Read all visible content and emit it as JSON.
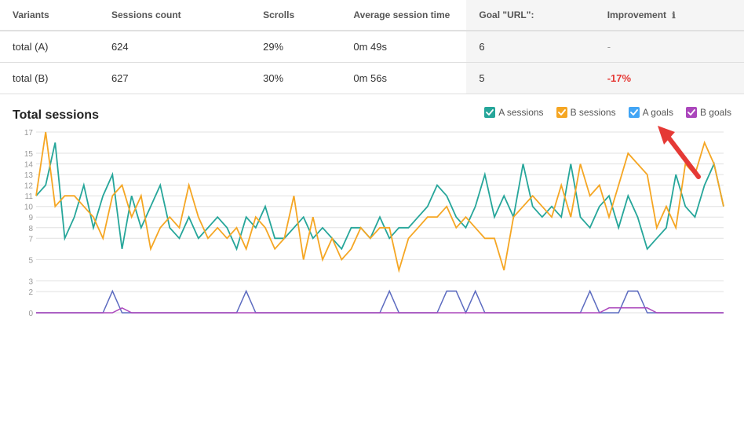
{
  "table": {
    "headers": [
      "Variants",
      "Sessions count",
      "Scrolls",
      "Average session time",
      "Goal \"URL\":",
      "Improvement"
    ],
    "rows": [
      {
        "variant": "total (A)",
        "sessions": "624",
        "scrolls": "29%",
        "avg_session": "0m 49s",
        "goal": "6",
        "improvement": "-",
        "improvement_type": "dash"
      },
      {
        "variant": "total (B)",
        "sessions": "627",
        "scrolls": "30%",
        "avg_session": "0m 56s",
        "goal": "5",
        "improvement": "-17%",
        "improvement_type": "negative"
      }
    ]
  },
  "chart": {
    "title": "Total sessions",
    "legend": [
      {
        "label": "A sessions",
        "color": "#26a69a",
        "type": "check"
      },
      {
        "label": "B sessions",
        "color": "#f5a623",
        "type": "check"
      },
      {
        "label": "A goals",
        "color": "#42a5f5",
        "type": "check"
      },
      {
        "label": "B goals",
        "color": "#ab47bc",
        "type": "check"
      }
    ],
    "y_labels": [
      "0",
      "2",
      "3",
      "5",
      "7",
      "8",
      "9",
      "10",
      "11",
      "12",
      "13",
      "14",
      "15",
      "17"
    ],
    "y_axis": [
      0,
      2,
      3,
      5,
      7,
      8,
      9,
      10,
      11,
      12,
      13,
      14,
      15,
      17
    ],
    "colors": {
      "a_sessions": "#26a69a",
      "b_sessions": "#f5a623",
      "a_goals": "#5c6bc0",
      "b_goals": "#ab47bc"
    }
  },
  "info_icon": "ℹ"
}
